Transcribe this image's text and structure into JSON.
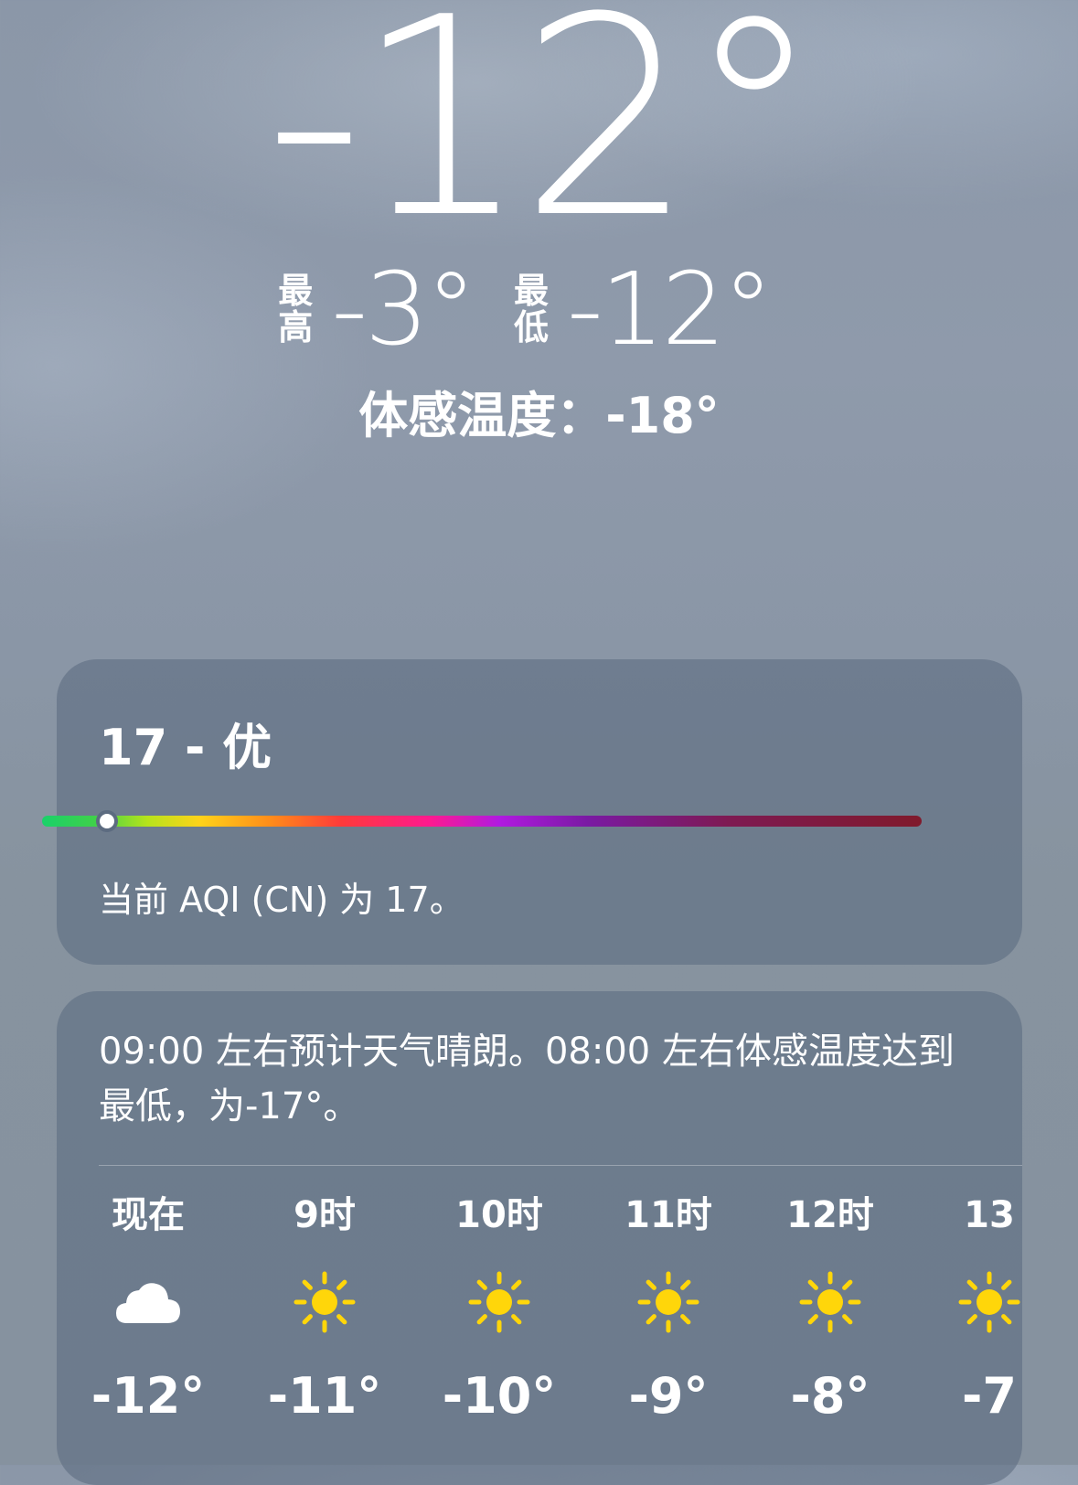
{
  "current": {
    "temperature": "-12°",
    "high_label": [
      "最",
      "高"
    ],
    "high_value": "-3°",
    "low_label": [
      "最",
      "低"
    ],
    "low_value": "-12°",
    "feels_like": "体感温度：-18°"
  },
  "aqi": {
    "title": "17 - 优",
    "value": 17,
    "scale_max": 500,
    "description": "当前 AQI (CN) 为 17。"
  },
  "forecast": {
    "summary": "09:00 左右预计天气晴朗。08:00 左右体感温度达到最低，为-17°。",
    "hours": [
      {
        "time": "现在",
        "icon": "cloud-icon",
        "temp": "-12°"
      },
      {
        "time": "9时",
        "icon": "sun-icon",
        "temp": "-11°"
      },
      {
        "time": "10时",
        "icon": "sun-icon",
        "temp": "-10°"
      },
      {
        "time": "11时",
        "icon": "sun-icon",
        "temp": "-9°"
      },
      {
        "time": "12时",
        "icon": "sun-icon",
        "temp": "-8°"
      },
      {
        "time": "13",
        "icon": "sun-icon",
        "temp": "-7"
      }
    ]
  },
  "colors": {
    "sun": "#ffd60a",
    "cloud": "#ffffff"
  }
}
